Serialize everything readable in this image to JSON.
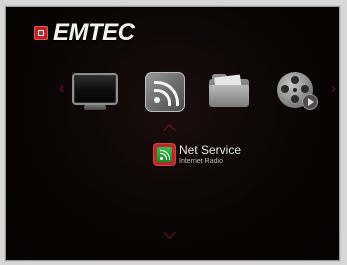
{
  "brand": {
    "logo_text": "EMTEC"
  },
  "menu": {
    "items": [
      {
        "name": "TV",
        "icon": "tv-icon"
      },
      {
        "name": "Net Service",
        "icon": "rss-icon"
      },
      {
        "name": "Files",
        "icon": "folder-icon"
      },
      {
        "name": "Movies",
        "icon": "film-reel-icon"
      }
    ],
    "selected": {
      "title": "Net Service",
      "subtitle": "Internet Radio",
      "icon": "rss-icon"
    },
    "left_arrow": "‹",
    "right_arrow": "›"
  },
  "colors": {
    "accent": "#b82a2a",
    "background": "#0a0505",
    "bezel": "#c9c9c9"
  }
}
